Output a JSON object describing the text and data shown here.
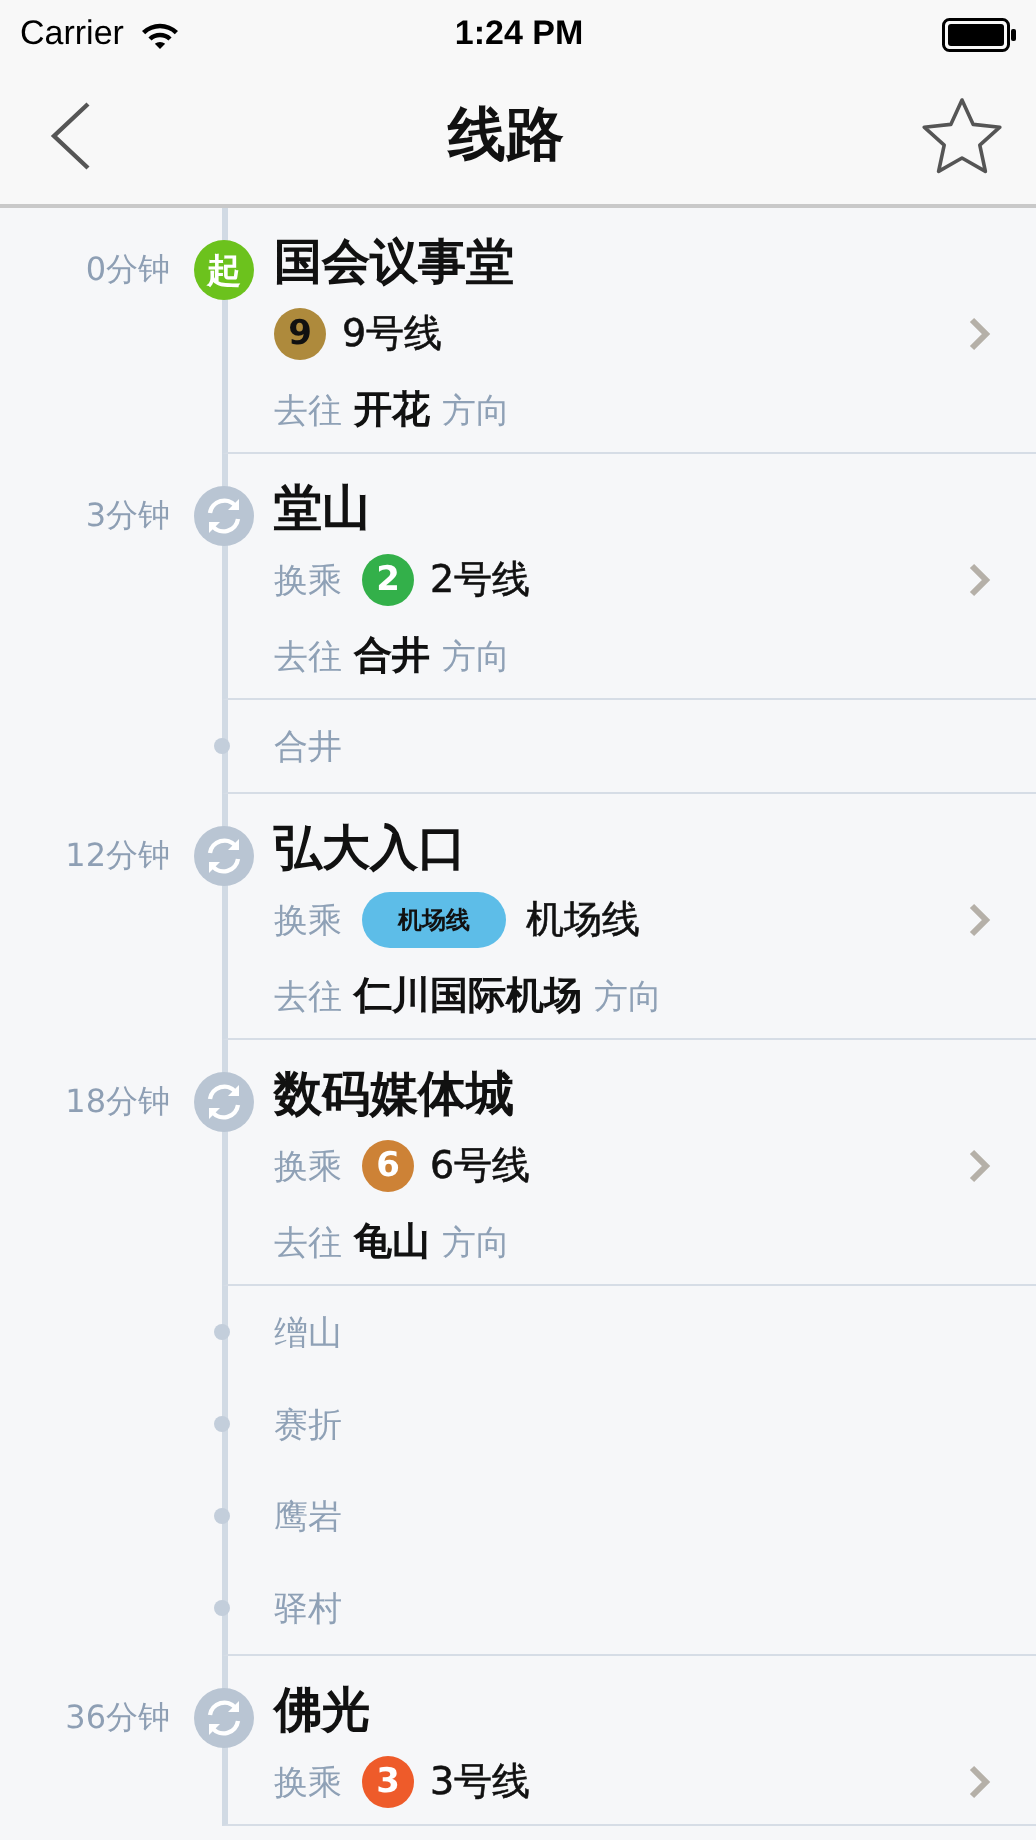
{
  "status_bar": {
    "carrier": "Carrier",
    "time": "1:24 PM"
  },
  "nav": {
    "title": "线路"
  },
  "route": [
    {
      "kind": "station",
      "time": "0分钟",
      "marker": {
        "kind": "start",
        "text": "起"
      },
      "name": "国会议事堂",
      "line": {
        "badge": {
          "kind": "circle",
          "text": "9",
          "dark_text": true,
          "color": "#ae8a3c"
        },
        "name": "9号线"
      },
      "direction": {
        "prefix": "去往",
        "name": "开花",
        "suffix": "方向"
      }
    },
    {
      "kind": "station",
      "time": "3分钟",
      "marker": {
        "kind": "transfer"
      },
      "name": "堂山",
      "line": {
        "label": "换乘",
        "badge": {
          "kind": "circle",
          "text": "2",
          "dark_text": false,
          "color": "#33b04a"
        },
        "name": "2号线"
      },
      "direction": {
        "prefix": "去往",
        "name": "合井",
        "suffix": "方向"
      }
    },
    {
      "kind": "stops",
      "stops": [
        "合井"
      ]
    },
    {
      "kind": "station",
      "time": "12分钟",
      "marker": {
        "kind": "transfer"
      },
      "name": "弘大入口",
      "line": {
        "label": "换乘",
        "badge": {
          "kind": "pill",
          "text": "机场线",
          "dark_text": true,
          "color": "#5dbde8"
        },
        "name": "机场线"
      },
      "direction": {
        "prefix": "去往",
        "name": "仁川国际机场",
        "suffix": "方向"
      }
    },
    {
      "kind": "station",
      "time": "18分钟",
      "marker": {
        "kind": "transfer"
      },
      "name": "数码媒体城",
      "line": {
        "label": "换乘",
        "badge": {
          "kind": "circle",
          "text": "6",
          "dark_text": false,
          "color": "#cd8236"
        },
        "name": "6号线"
      },
      "direction": {
        "prefix": "去往",
        "name": "龟山",
        "suffix": "方向"
      }
    },
    {
      "kind": "stops",
      "stops": [
        "缯山",
        "赛折",
        "鹰岩",
        "驿村"
      ]
    },
    {
      "kind": "station",
      "time": "36分钟",
      "marker": {
        "kind": "transfer"
      },
      "name": "佛光",
      "line": {
        "label": "换乘",
        "badge": {
          "kind": "circle",
          "text": "3",
          "dark_text": false,
          "color": "#ee5b2a"
        },
        "name": "3号线"
      }
    }
  ]
}
